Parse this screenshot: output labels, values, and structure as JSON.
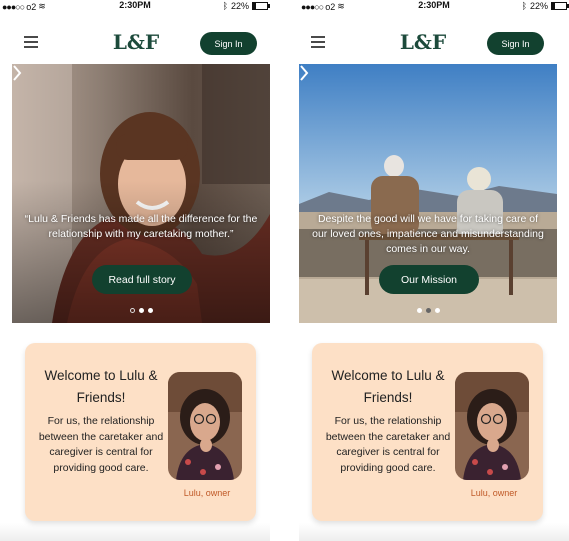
{
  "phones": [
    {
      "status": {
        "carrier": "o2",
        "time": "2:30PM",
        "battery": "22%"
      },
      "header": {
        "logo": "L&F",
        "signin_label": "Sign In"
      },
      "hero": {
        "quote": "“Lulu & Friends has made all the difference for the relationship with my caretaking mother.”",
        "cta_label": "Read full story",
        "active_slide": 2
      },
      "welcome": {
        "title": "Welcome to Lulu & Friends!",
        "body": "For us, the relationship between the caretaker and caregiver is central for providing good care.",
        "caption": "Lulu, owner"
      }
    },
    {
      "status": {
        "carrier": "o2",
        "time": "2:30PM",
        "battery": "22%"
      },
      "header": {
        "logo": "L&F",
        "signin_label": "Sign In"
      },
      "hero": {
        "quote": "Despite the good will we have for taking care of our loved ones, impatience and misunderstanding comes in our way.",
        "cta_label": "Our Mission",
        "active_slide": 2
      },
      "welcome": {
        "title": "Welcome to Lulu & Friends!",
        "body": "For us, the relationship between the caretaker and caregiver is central for providing good care.",
        "caption": "Lulu, owner"
      }
    }
  ],
  "colors": {
    "brand": "#12412f",
    "card": "#fde0c6",
    "caption": "#c05a28"
  }
}
